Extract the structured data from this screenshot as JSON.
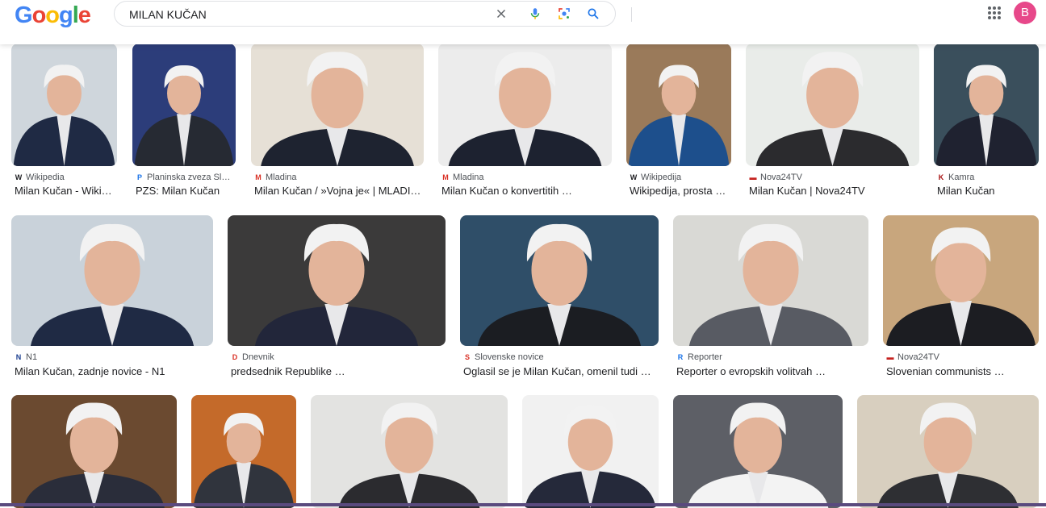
{
  "header": {
    "logo": [
      "G",
      "o",
      "o",
      "g",
      "l",
      "e"
    ],
    "query": "MILAN KUČAN",
    "avatar_letter": "B"
  },
  "results_row1": [
    {
      "source": "Wikipedia",
      "title": "Milan Kučan - Wiki…",
      "fav": "W",
      "favcolor": "#202124"
    },
    {
      "source": "Planinska zveza Sl…",
      "title": "PZS: Milan Kučan",
      "fav": "P",
      "favcolor": "#1a73e8"
    },
    {
      "source": "Mladina",
      "title": "Milan Kučan / »Vojna je« | MLADI…",
      "fav": "M",
      "favcolor": "#d93025"
    },
    {
      "source": "Mladina",
      "title": "Milan Kučan o konvertitih …",
      "fav": "M",
      "favcolor": "#d93025"
    },
    {
      "source": "Wikipedija",
      "title": "Wikipedija, prosta …",
      "fav": "W",
      "favcolor": "#202124"
    },
    {
      "source": "Nova24TV",
      "title": "Milan Kučan | Nova24TV",
      "fav": "▬",
      "favcolor": "#c5221f"
    },
    {
      "source": "Kamra",
      "title": "Milan Kučan",
      "fav": "K",
      "favcolor": "#a50e0e"
    }
  ],
  "results_row2": [
    {
      "source": "N1",
      "title": "Milan Kučan, zadnje novice - N1",
      "fav": "N",
      "favcolor": "#1a3d8f"
    },
    {
      "source": "Dnevnik",
      "title": "predsednik Republike …",
      "fav": "D",
      "favcolor": "#d93025"
    },
    {
      "source": "Slovenske novice",
      "title": "Oglasil se je Milan Kučan, omenil tudi …",
      "fav": "S",
      "favcolor": "#d93025"
    },
    {
      "source": "Reporter",
      "title": "Reporter o evropskih volitvah …",
      "fav": "R",
      "favcolor": "#1a73e8"
    },
    {
      "source": "Nova24TV",
      "title": "Slovenian communists …",
      "fav": "▬",
      "favcolor": "#c5221f"
    }
  ],
  "colors": {
    "accent": "#1a73e8",
    "avatar": "#e7488a",
    "bottombar": "#5a4a7e"
  }
}
